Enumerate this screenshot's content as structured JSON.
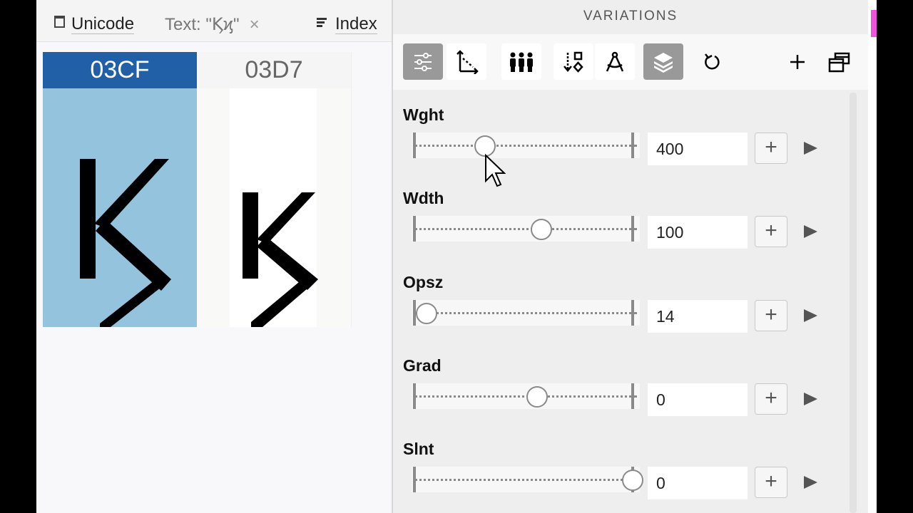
{
  "tabs": {
    "unicode": "Unicode",
    "text": "Text: \"Ϗϗ\"",
    "close_symbol": "×",
    "index": "Index"
  },
  "glyphs": [
    {
      "code": "03CF",
      "selected": true
    },
    {
      "code": "03D7",
      "selected": false
    }
  ],
  "panel": {
    "title": "VARIATIONS",
    "toolbar_icons": [
      "sliders-icon",
      "axes-icon",
      "people-icon",
      "sort-icon",
      "compass-icon",
      "layers-icon",
      "reset-icon",
      "add-icon",
      "windows-icon"
    ],
    "active_icons": [
      "sliders-icon",
      "layers-icon"
    ]
  },
  "axes": [
    {
      "name": "Wght",
      "value": "400",
      "position": 0.31
    },
    {
      "name": "Wdth",
      "value": "100",
      "position": 0.57
    },
    {
      "name": "Opsz",
      "value": "14",
      "position": 0.04
    },
    {
      "name": "Grad",
      "value": "0",
      "position": 0.55
    },
    {
      "name": "Slnt",
      "value": "0",
      "position": 0.99
    }
  ],
  "buttons": {
    "plus": "+"
  },
  "colors": {
    "selected_header": "#2160a6",
    "selected_cell": "#94c3dd",
    "accent_magenta": "#f052e0"
  }
}
